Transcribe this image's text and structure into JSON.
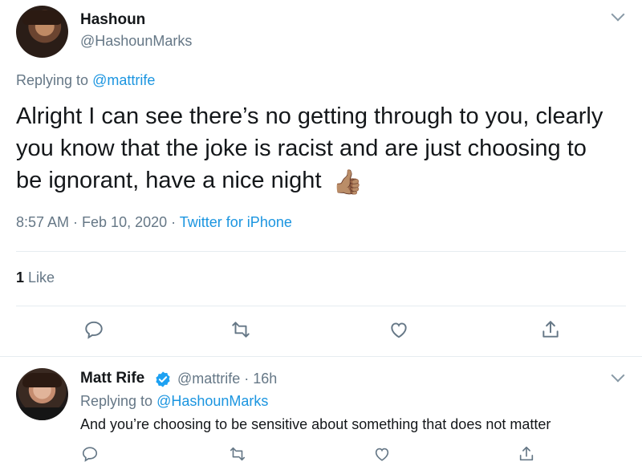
{
  "main_tweet": {
    "display_name": "Hashoun",
    "handle": "@HashounMarks",
    "replying_prefix": "Replying to",
    "replying_to": "@mattrife",
    "text": "Alright I can see there’s no getting through to you, clearly you know that the joke is racist and are just choosing to be ignorant, have a nice night",
    "emoji": "👍🏽",
    "time": "8:57 AM · Feb 10, 2020 · ",
    "source": "Twitter for iPhone",
    "likes_count": "1",
    "likes_label": "Like",
    "icons": [
      "chevron-down-icon",
      "reply-icon",
      "retweet-icon",
      "like-icon",
      "share-icon"
    ]
  },
  "reply_tweet": {
    "display_name": "Matt Rife",
    "handle_time": "@mattrife · 16h",
    "replying_prefix": "Replying to",
    "replying_to": "@HashounMarks",
    "text": "And you’re choosing to be sensitive about something that does not matter",
    "icons": [
      "verified-badge-icon",
      "chevron-down-icon",
      "reply-icon",
      "retweet-icon",
      "like-icon",
      "share-icon"
    ]
  },
  "colors": {
    "link": "#1b95e0",
    "secondary_text": "#657786",
    "primary_text": "#14171a",
    "divider": "#e6ecf0"
  }
}
